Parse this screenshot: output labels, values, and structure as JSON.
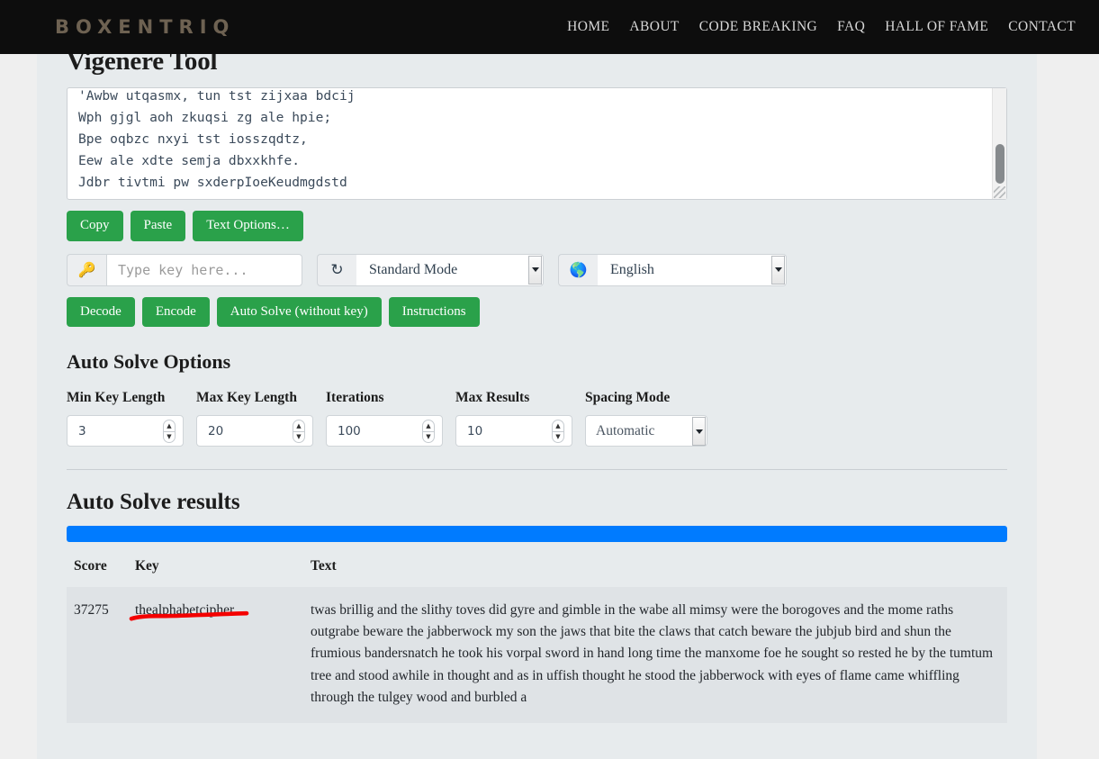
{
  "header": {
    "brand": "BOXENTRIQ",
    "nav": [
      {
        "label": "HOME"
      },
      {
        "label": "ABOUT"
      },
      {
        "label": "CODE BREAKING"
      },
      {
        "label": "FAQ"
      },
      {
        "label": "HALL OF FAME"
      },
      {
        "label": "CONTACT"
      }
    ]
  },
  "page": {
    "title": "Vigenere Tool"
  },
  "cipher": {
    "text": "'Awbw utqasmx, tun tst zijxaa bdcij\nWph gjgl aoh zkuqsi zg ale hpie;\nBpe oqbzc nxyi tst iosszqdtz,\nEew ale xdte semja dbxxkhfe.\nJdbr tivtmi pw sxderpIoeKeudmgdstd"
  },
  "text_buttons": [
    {
      "label": "Copy",
      "name": "copy-button"
    },
    {
      "label": "Paste",
      "name": "paste-button"
    },
    {
      "label": "Text Options…",
      "name": "text-options-button"
    }
  ],
  "key_row": {
    "key_icon": "key-icon",
    "key_placeholder": "Type key here...",
    "key_value": "",
    "refresh_icon": "refresh-icon",
    "mode_value": "Standard Mode",
    "globe_icon": "globe-icon",
    "language_value": "English"
  },
  "action_buttons": [
    {
      "label": "Decode",
      "name": "decode-button"
    },
    {
      "label": "Encode",
      "name": "encode-button"
    },
    {
      "label": "Auto Solve (without key)",
      "name": "auto-solve-button"
    },
    {
      "label": "Instructions",
      "name": "instructions-button"
    }
  ],
  "auto_solve_options": {
    "title": "Auto Solve Options",
    "fields": [
      {
        "label": "Min Key Length",
        "value": "3",
        "name": "min-key-length"
      },
      {
        "label": "Max Key Length",
        "value": "20",
        "name": "max-key-length"
      },
      {
        "label": "Iterations",
        "value": "100",
        "name": "iterations"
      },
      {
        "label": "Max Results",
        "value": "10",
        "name": "max-results"
      }
    ],
    "spacing": {
      "label": "Spacing Mode",
      "value": "Automatic"
    }
  },
  "results": {
    "title": "Auto Solve results",
    "progress_percent": 100,
    "progress_color": "#007bff",
    "columns": [
      "Score",
      "Key",
      "Text"
    ],
    "rows": [
      {
        "score": "37275",
        "key": "thealphabetcipher",
        "text": "twas brillig and the slithy toves did gyre and gimble in the wabe all mimsy were the borogoves and the mome raths outgrabe beware the jabberwock my son the jaws that bite the claws that catch beware the jubjub bird and shun the frumious bandersnatch he took his vorpal sword in hand long time the manxome foe he sought so rested he by the tumtum tree and stood awhile in thought and as in uffish thought he stood the jabberwock with eyes of flame came whiffling through the tulgey wood and burbled a"
      }
    ]
  },
  "annotation": {
    "color": "#f40000",
    "shape": "underline-stroke"
  },
  "colors": {
    "nav_background": "#0d0d0d",
    "brand": "#6e6252",
    "button_green": "#2aa14a",
    "container_background": "#e7ebed",
    "page_background": "#efefef"
  }
}
